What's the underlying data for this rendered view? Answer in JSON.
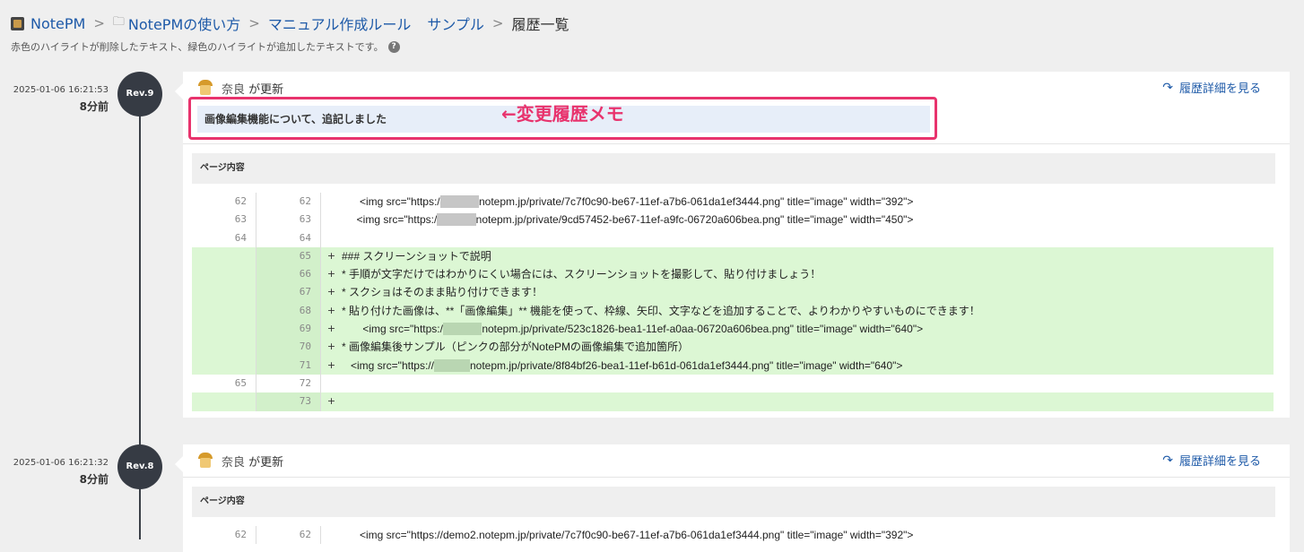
{
  "breadcrumb": {
    "root": "NotePM",
    "folder": "NotePMの使い方",
    "category": "マニュアル作成ルール",
    "page": "サンプル",
    "current": "履歴一覧"
  },
  "hint": "赤色のハイライトが削除したテキスト、緑色のハイライトが追加したテキストです。",
  "hint_icon": "question-icon",
  "colors": {
    "link": "#1e5aa8",
    "added": "#dcf7d4",
    "annotation": "#e8336d",
    "rev_badge": "#363b44"
  },
  "revisions": [
    {
      "timestamp": "2025-01-06 16:21:53",
      "ago": "8分前",
      "rev": "Rev.9",
      "author": "奈良",
      "action": "が更新",
      "detail_link": "履歴詳細を見る",
      "memo": "画像編集機能について、追記しました",
      "annotation": "←変更履歴メモ",
      "section": "ページ内容",
      "lines": [
        {
          "old": "62",
          "new": "62",
          "mark": "",
          "type": "same",
          "pre": "      <img src=\"https:/",
          "blur": "/demo2.",
          "post": "notepm.jp/private/7c7f0c90-be67-11ef-a7b6-061da1ef3444.png\" title=\"image\" width=\"392\">"
        },
        {
          "old": "63",
          "new": "63",
          "mark": "",
          "type": "same",
          "pre": "     <img src=\"https:/",
          "blur": "/demo2.",
          "post": "notepm.jp/private/9cd57452-be67-11ef-a9fc-06720a606bea.png\" title=\"image\" width=\"450\">"
        },
        {
          "old": "64",
          "new": "64",
          "mark": "",
          "type": "same",
          "pre": "",
          "blur": "",
          "post": ""
        },
        {
          "old": "",
          "new": "65",
          "mark": "+",
          "type": "add",
          "pre": "### スクリーンショットで説明",
          "blur": "",
          "post": ""
        },
        {
          "old": "",
          "new": "66",
          "mark": "+",
          "type": "add",
          "pre": "* 手順が文字だけではわかりにくい場合には、スクリーンショットを撮影して、貼り付けましょう！",
          "blur": "",
          "post": ""
        },
        {
          "old": "",
          "new": "67",
          "mark": "+",
          "type": "add",
          "pre": "* スクショはそのまま貼り付けできます！",
          "blur": "",
          "post": ""
        },
        {
          "old": "",
          "new": "68",
          "mark": "+",
          "type": "add",
          "pre": "* 貼り付けた画像は、**「画像編集」** 機能を使って、枠線、矢印、文字などを追加することで、よりわかりやすいものにできます！",
          "blur": "",
          "post": ""
        },
        {
          "old": "",
          "new": "69",
          "mark": "+",
          "type": "add",
          "pre": "       <img src=\"https:/",
          "blur": "/demo2.",
          "post": "notepm.jp/private/523c1826-bea1-11ef-a0aa-06720a606bea.png\" title=\"image\" width=\"640\">"
        },
        {
          "old": "",
          "new": "70",
          "mark": "+",
          "type": "add",
          "pre": "* 画像編集後サンプル（ピンクの部分がNotePMの画像編集で追加箇所）",
          "blur": "",
          "post": ""
        },
        {
          "old": "",
          "new": "71",
          "mark": "+",
          "type": "add",
          "pre": "   <img src=\"https://",
          "blur": "demo2.",
          "post": "notepm.jp/private/8f84bf26-bea1-11ef-b61d-061da1ef3444.png\" title=\"image\" width=\"640\">"
        },
        {
          "old": "65",
          "new": "72",
          "mark": "",
          "type": "same",
          "pre": "",
          "blur": "",
          "post": ""
        },
        {
          "old": "",
          "new": "73",
          "mark": "+",
          "type": "add",
          "pre": "",
          "blur": "",
          "post": ""
        }
      ]
    },
    {
      "timestamp": "2025-01-06 16:21:32",
      "ago": "8分前",
      "rev": "Rev.8",
      "author": "奈良",
      "action": "が更新",
      "detail_link": "履歴詳細を見る",
      "section": "ページ内容",
      "lines": [
        {
          "old": "62",
          "new": "62",
          "mark": "",
          "type": "same",
          "pre": "      <img src=\"https://demo2.notepm.jp/private/7c7f0c90-be67-11ef-a7b6-061da1ef3444.png\" title=\"image\" width=\"392\">",
          "blur": "",
          "post": ""
        }
      ]
    }
  ]
}
